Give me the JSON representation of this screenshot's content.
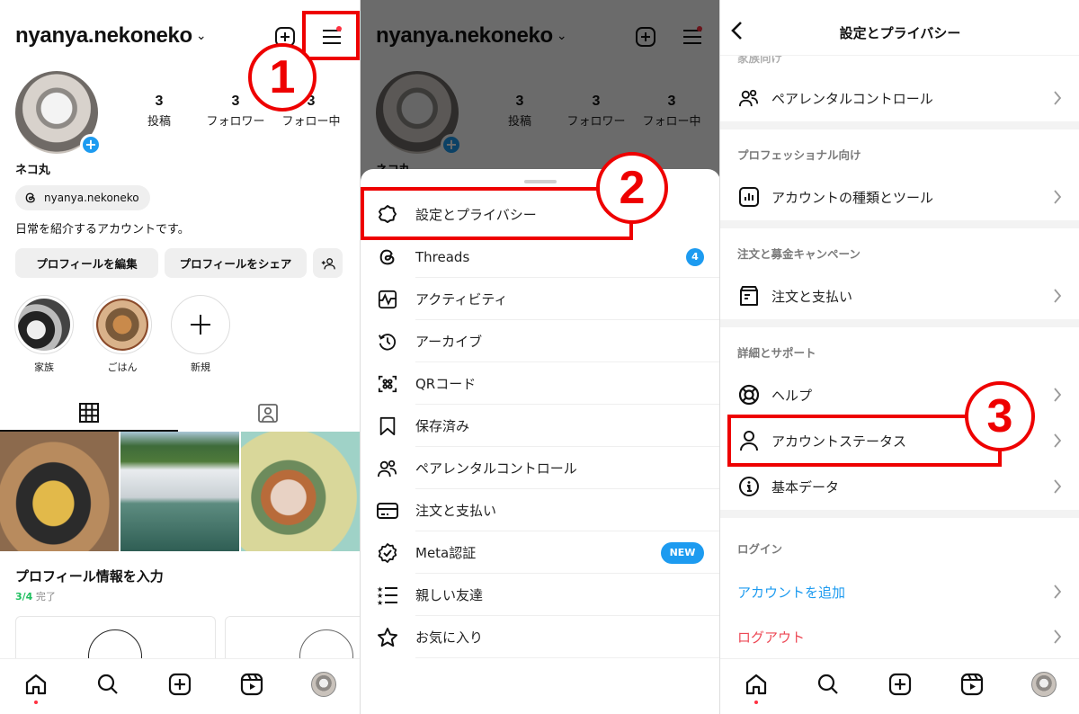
{
  "annotations": {
    "step1": "1",
    "step2": "2",
    "step3": "3",
    "color": "#ee0000"
  },
  "profile": {
    "username": "nyanya.nekoneko",
    "stats": [
      {
        "value": "3",
        "label": "投稿"
      },
      {
        "value": "3",
        "label": "フォロワー"
      },
      {
        "value": "3",
        "label": "フォロー中"
      }
    ],
    "display_name": "ネコ丸",
    "threads_handle": "nyanya.nekoneko",
    "bio": "日常を紹介するアカウントです。",
    "buttons": {
      "edit": "プロフィールを編集",
      "share": "プロフィールをシェア"
    },
    "highlights": [
      {
        "label": "家族"
      },
      {
        "label": "ごはん"
      },
      {
        "label": "新規"
      }
    ],
    "section_title": "プロフィール情報を入力",
    "progress_count": "3/4",
    "progress_label": "完了"
  },
  "menu": {
    "items": [
      {
        "label": "設定とプライバシー",
        "icon": "settings-gear-icon"
      },
      {
        "label": "Threads",
        "icon": "threads-icon",
        "count": "4"
      },
      {
        "label": "アクティビティ",
        "icon": "activity-icon"
      },
      {
        "label": "アーカイブ",
        "icon": "archive-history-icon"
      },
      {
        "label": "QRコード",
        "icon": "qr-code-icon"
      },
      {
        "label": "保存済み",
        "icon": "bookmark-icon"
      },
      {
        "label": "ペアレンタルコントロール",
        "icon": "parental-control-icon"
      },
      {
        "label": "注文と支払い",
        "icon": "credit-card-icon"
      },
      {
        "label": "Meta認証",
        "icon": "verified-badge-icon",
        "badge": "NEW"
      },
      {
        "label": "親しい友達",
        "icon": "close-friends-list-icon"
      },
      {
        "label": "お気に入り",
        "icon": "star-icon"
      }
    ]
  },
  "settings": {
    "title": "設定とプライバシー",
    "sections": [
      {
        "label": "家族向け",
        "items": [
          {
            "label": "ペアレンタルコントロール"
          }
        ]
      },
      {
        "label": "プロフェッショナル向け",
        "items": [
          {
            "label": "アカウントの種類とツール"
          }
        ]
      },
      {
        "label": "注文と募金キャンペーン",
        "items": [
          {
            "label": "注文と支払い"
          }
        ]
      },
      {
        "label": "詳細とサポート",
        "items": [
          {
            "label": "ヘルプ"
          },
          {
            "label": "アカウントステータス"
          },
          {
            "label": "基本データ"
          }
        ]
      },
      {
        "label": "ログイン",
        "items": [
          {
            "label": "アカウントを追加",
            "color": "#1d9bf0"
          },
          {
            "label": "ログアウト",
            "color": "#ed4956"
          }
        ]
      }
    ]
  },
  "colors": {
    "accent_blue": "#1d9bf0",
    "notification_red": "#ff3040",
    "progress_green": "#1fbf5f"
  }
}
